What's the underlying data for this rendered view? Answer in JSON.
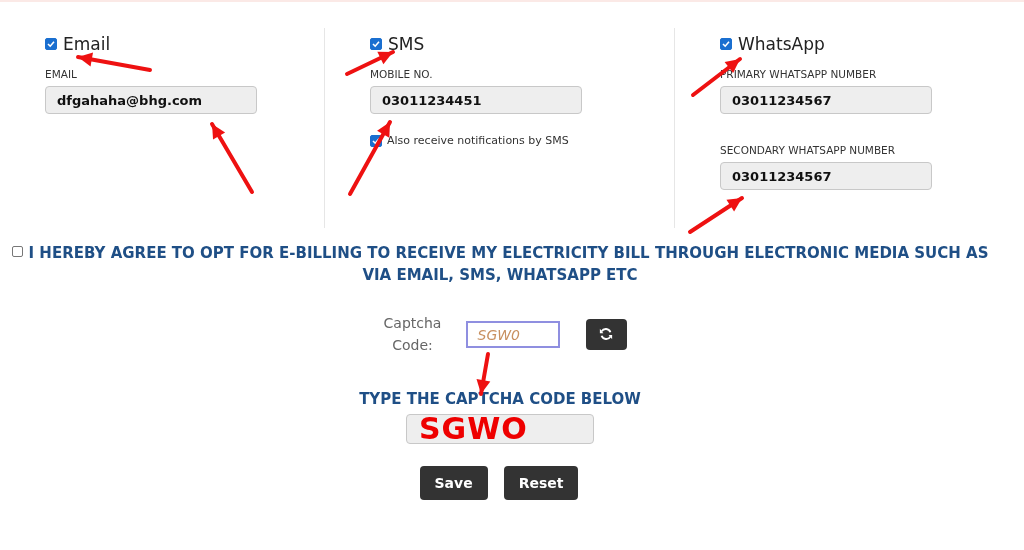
{
  "channels": [
    {
      "label": "Email",
      "checked": true,
      "fields": [
        {
          "label": "EMAIL",
          "value": "dfgahaha@bhg.com"
        }
      ]
    },
    {
      "label": "SMS",
      "checked": true,
      "fields": [
        {
          "label": "MOBILE NO.",
          "value": "03011234451"
        }
      ],
      "option": {
        "label": "Also receive notifications by SMS",
        "checked": true
      }
    },
    {
      "label": "WhatsApp",
      "checked": true,
      "fields": [
        {
          "label": "PRIMARY WHATSAPP NUMBER",
          "value": "03011234567"
        },
        {
          "label": "SECONDARY WHATSAPP NUMBER",
          "value": "03011234567"
        }
      ]
    }
  ],
  "agreement": {
    "checked": false,
    "text": "I HEREBY AGREE TO OPT FOR E-BILLING TO RECEIVE MY ELECTRICITY BILL THROUGH ELECTRONIC MEDIA SUCH AS VIA EMAIL, SMS, WHATSAPP ETC"
  },
  "captcha": {
    "label": "Captcha Code:",
    "code": "SGW0",
    "prompt": "TYPE THE CAPTCHA CODE BELOW",
    "handwritten": "SGWO"
  },
  "buttons": [
    "Save",
    "Reset"
  ]
}
